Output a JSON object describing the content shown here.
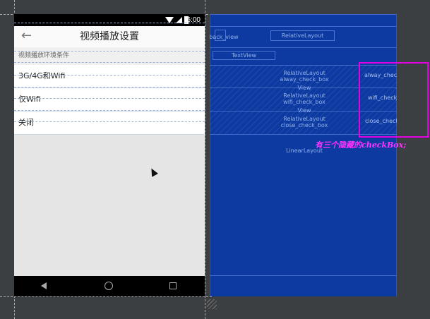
{
  "status_bar": {
    "time": "6:00"
  },
  "toolbar": {
    "back_glyph": "←",
    "title": "视频播放设置"
  },
  "section_label": "视频播放环境条件",
  "options": [
    {
      "label": "3G/4G和Wifi"
    },
    {
      "label": "仅Wifi"
    },
    {
      "label": "关闭"
    }
  ],
  "blueprint": {
    "back_view": "back_view",
    "relative_layout_top": "RelativeLayout",
    "text_view": "TextView",
    "rows": [
      {
        "overlap_line1": "RelativeLayout",
        "overlap_line2": "alway_check_box",
        "right_label": "alway_check_box"
      },
      {
        "overlap_line1": "RelativeLayout",
        "overlap_line2": "wifi_check_box",
        "right_label": "wifi_check_box"
      },
      {
        "overlap_line1": "RelativeLayout",
        "overlap_line2": "close_check_box",
        "right_label": "close_check_box"
      }
    ],
    "view_label": "View",
    "linear_layout": "LinearLayout"
  },
  "annotation": "有三个隐藏的checkBox;",
  "colors": {
    "blueprint_bg": "#0d3aa0",
    "highlight": "#e300e3",
    "annotation": "#ff33ff",
    "canvas_bg": "#3c3f41"
  },
  "icons": [
    "wifi-icon",
    "signal-icon",
    "battery-icon",
    "back-arrow-icon",
    "nav-back-icon",
    "nav-home-icon",
    "nav-recent-icon",
    "mouse-cursor-icon"
  ]
}
